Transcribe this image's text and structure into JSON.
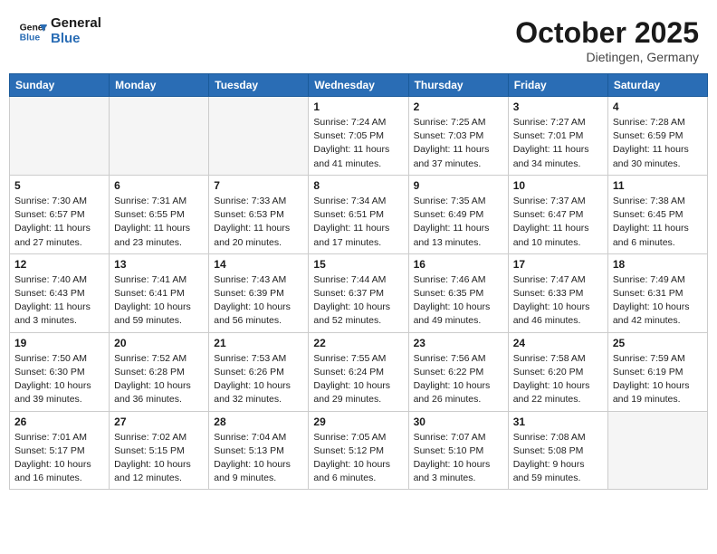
{
  "header": {
    "logo_line1": "General",
    "logo_line2": "Blue",
    "month": "October 2025",
    "location": "Dietingen, Germany"
  },
  "days_of_week": [
    "Sunday",
    "Monday",
    "Tuesday",
    "Wednesday",
    "Thursday",
    "Friday",
    "Saturday"
  ],
  "weeks": [
    [
      {
        "num": "",
        "info": ""
      },
      {
        "num": "",
        "info": ""
      },
      {
        "num": "",
        "info": ""
      },
      {
        "num": "1",
        "info": "Sunrise: 7:24 AM\nSunset: 7:05 PM\nDaylight: 11 hours\nand 41 minutes."
      },
      {
        "num": "2",
        "info": "Sunrise: 7:25 AM\nSunset: 7:03 PM\nDaylight: 11 hours\nand 37 minutes."
      },
      {
        "num": "3",
        "info": "Sunrise: 7:27 AM\nSunset: 7:01 PM\nDaylight: 11 hours\nand 34 minutes."
      },
      {
        "num": "4",
        "info": "Sunrise: 7:28 AM\nSunset: 6:59 PM\nDaylight: 11 hours\nand 30 minutes."
      }
    ],
    [
      {
        "num": "5",
        "info": "Sunrise: 7:30 AM\nSunset: 6:57 PM\nDaylight: 11 hours\nand 27 minutes."
      },
      {
        "num": "6",
        "info": "Sunrise: 7:31 AM\nSunset: 6:55 PM\nDaylight: 11 hours\nand 23 minutes."
      },
      {
        "num": "7",
        "info": "Sunrise: 7:33 AM\nSunset: 6:53 PM\nDaylight: 11 hours\nand 20 minutes."
      },
      {
        "num": "8",
        "info": "Sunrise: 7:34 AM\nSunset: 6:51 PM\nDaylight: 11 hours\nand 17 minutes."
      },
      {
        "num": "9",
        "info": "Sunrise: 7:35 AM\nSunset: 6:49 PM\nDaylight: 11 hours\nand 13 minutes."
      },
      {
        "num": "10",
        "info": "Sunrise: 7:37 AM\nSunset: 6:47 PM\nDaylight: 11 hours\nand 10 minutes."
      },
      {
        "num": "11",
        "info": "Sunrise: 7:38 AM\nSunset: 6:45 PM\nDaylight: 11 hours\nand 6 minutes."
      }
    ],
    [
      {
        "num": "12",
        "info": "Sunrise: 7:40 AM\nSunset: 6:43 PM\nDaylight: 11 hours\nand 3 minutes."
      },
      {
        "num": "13",
        "info": "Sunrise: 7:41 AM\nSunset: 6:41 PM\nDaylight: 10 hours\nand 59 minutes."
      },
      {
        "num": "14",
        "info": "Sunrise: 7:43 AM\nSunset: 6:39 PM\nDaylight: 10 hours\nand 56 minutes."
      },
      {
        "num": "15",
        "info": "Sunrise: 7:44 AM\nSunset: 6:37 PM\nDaylight: 10 hours\nand 52 minutes."
      },
      {
        "num": "16",
        "info": "Sunrise: 7:46 AM\nSunset: 6:35 PM\nDaylight: 10 hours\nand 49 minutes."
      },
      {
        "num": "17",
        "info": "Sunrise: 7:47 AM\nSunset: 6:33 PM\nDaylight: 10 hours\nand 46 minutes."
      },
      {
        "num": "18",
        "info": "Sunrise: 7:49 AM\nSunset: 6:31 PM\nDaylight: 10 hours\nand 42 minutes."
      }
    ],
    [
      {
        "num": "19",
        "info": "Sunrise: 7:50 AM\nSunset: 6:30 PM\nDaylight: 10 hours\nand 39 minutes."
      },
      {
        "num": "20",
        "info": "Sunrise: 7:52 AM\nSunset: 6:28 PM\nDaylight: 10 hours\nand 36 minutes."
      },
      {
        "num": "21",
        "info": "Sunrise: 7:53 AM\nSunset: 6:26 PM\nDaylight: 10 hours\nand 32 minutes."
      },
      {
        "num": "22",
        "info": "Sunrise: 7:55 AM\nSunset: 6:24 PM\nDaylight: 10 hours\nand 29 minutes."
      },
      {
        "num": "23",
        "info": "Sunrise: 7:56 AM\nSunset: 6:22 PM\nDaylight: 10 hours\nand 26 minutes."
      },
      {
        "num": "24",
        "info": "Sunrise: 7:58 AM\nSunset: 6:20 PM\nDaylight: 10 hours\nand 22 minutes."
      },
      {
        "num": "25",
        "info": "Sunrise: 7:59 AM\nSunset: 6:19 PM\nDaylight: 10 hours\nand 19 minutes."
      }
    ],
    [
      {
        "num": "26",
        "info": "Sunrise: 7:01 AM\nSunset: 5:17 PM\nDaylight: 10 hours\nand 16 minutes."
      },
      {
        "num": "27",
        "info": "Sunrise: 7:02 AM\nSunset: 5:15 PM\nDaylight: 10 hours\nand 12 minutes."
      },
      {
        "num": "28",
        "info": "Sunrise: 7:04 AM\nSunset: 5:13 PM\nDaylight: 10 hours\nand 9 minutes."
      },
      {
        "num": "29",
        "info": "Sunrise: 7:05 AM\nSunset: 5:12 PM\nDaylight: 10 hours\nand 6 minutes."
      },
      {
        "num": "30",
        "info": "Sunrise: 7:07 AM\nSunset: 5:10 PM\nDaylight: 10 hours\nand 3 minutes."
      },
      {
        "num": "31",
        "info": "Sunrise: 7:08 AM\nSunset: 5:08 PM\nDaylight: 9 hours\nand 59 minutes."
      },
      {
        "num": "",
        "info": ""
      }
    ]
  ]
}
